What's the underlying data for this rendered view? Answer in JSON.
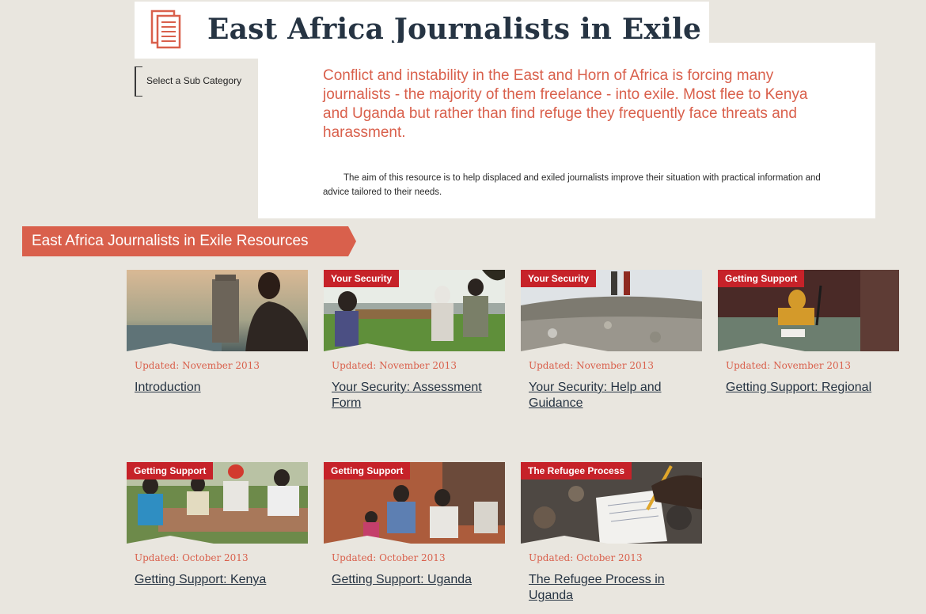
{
  "header": {
    "title": "East Africa Journalists in Exile"
  },
  "subcategory": {
    "label": "Select a Sub Category"
  },
  "intro": {
    "lead": "Conflict and instability in the East and Horn of Africa is forcing many journalists - the majority of them freelance - into exile. Most flee to Kenya and Uganda but rather than find refuge they frequently face threats and harassment.",
    "aim": "The aim of this resource is to help displaced and exiled journalists improve their situation with practical information and advice tailored to their needs."
  },
  "resources": {
    "title": "East Africa Journalists in Exile Resources",
    "cards": [
      {
        "tag": "",
        "updated": "Updated: November 2013",
        "title": "Introduction"
      },
      {
        "tag": "Your Security",
        "updated": "Updated: November 2013",
        "title": "Your Security: Assessment Form"
      },
      {
        "tag": "Your Security",
        "updated": "Updated: November 2013",
        "title": "Your Security: Help and Guidance"
      },
      {
        "tag": "Getting Support",
        "updated": "Updated: November 2013",
        "title": "Getting Support: Regional"
      },
      {
        "tag": "Getting Support",
        "updated": "Updated: October 2013",
        "title": "Getting Support: Kenya"
      },
      {
        "tag": "Getting Support",
        "updated": "Updated: October 2013",
        "title": "Getting Support: Uganda"
      },
      {
        "tag": "The Refugee Process",
        "updated": "Updated: October 2013",
        "title": "The Refugee Process in Uganda"
      }
    ]
  },
  "colors": {
    "accent": "#d9604c",
    "tag": "#c62229",
    "text": "#263443",
    "background": "#e9e6df"
  },
  "icons": {
    "title": "document-icon",
    "select": "up-down-arrows-icon"
  }
}
